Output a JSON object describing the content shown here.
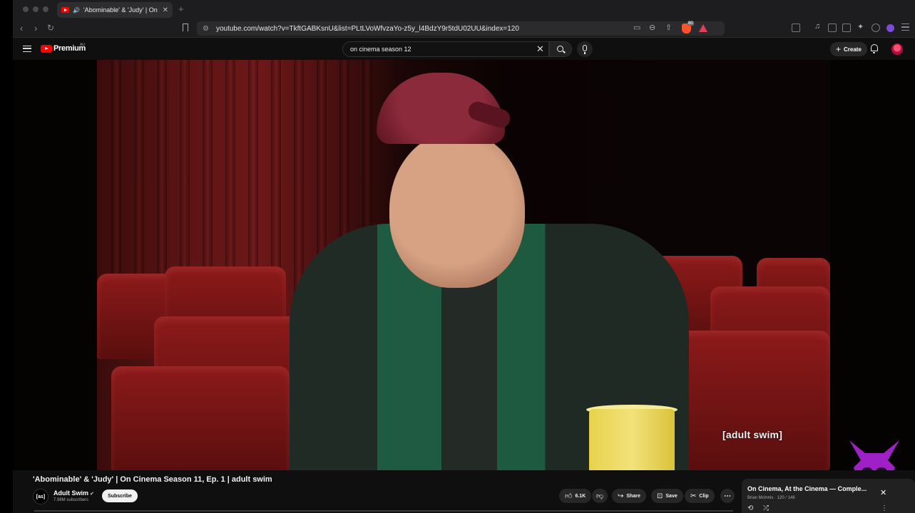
{
  "browser": {
    "tab": {
      "title": "'Abominable' & 'Judy' | On",
      "speaker_icon": "speaker-icon",
      "close_glyph": "✕"
    },
    "new_tab_glyph": "+",
    "url": "youtube.com/watch?v=TkftGABKsnU&list=PLtLVoWfvzaYo-z5y_l4BdzY9r5tdU02UU&index=120",
    "shield_badge": "80"
  },
  "youtube": {
    "logo_text": "Premium",
    "region": "AU",
    "search": {
      "value": "on cinema season 12",
      "clear_glyph": "✕"
    },
    "create_label": "Create",
    "create_plus": "+"
  },
  "video": {
    "watermark": "[adult swim]",
    "title": "'Abominable' & 'Judy' | On Cinema Season 11, Ep. 1 | adult swim"
  },
  "channel": {
    "avatar_text": "[as]",
    "name": "Adult Swim",
    "verified_glyph": "✔",
    "subscribers": "7.98M subscribers",
    "subscribe_label": "Subscribe"
  },
  "actions": {
    "likes": "6.1K",
    "share": "Share",
    "save": "Save",
    "clip": "Clip",
    "more": "⋯"
  },
  "playlist": {
    "title": "On Cinema, At the Cinema — Comple...",
    "owner_progress": "Brian McInnis · 120 / 146",
    "close_glyph": "✕",
    "dots_glyph": "⋮"
  },
  "colors": {
    "brand_red": "#ff0000",
    "background": "#0f0f0f",
    "button_bg": "#272727"
  }
}
